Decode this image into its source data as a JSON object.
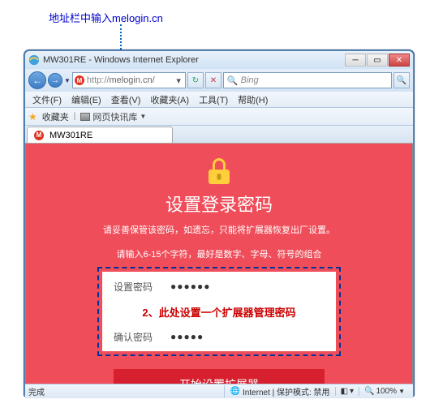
{
  "annotation": "地址栏中输入melogin.cn",
  "window": {
    "title": "MW301RE - Windows Internet Explorer",
    "url_prefix": "http://",
    "url_host": "melogin.cn/",
    "search_placeholder": "Bing"
  },
  "menu": {
    "file": "文件(F)",
    "edit": "编辑(E)",
    "view": "查看(V)",
    "favorites": "收藏夹(A)",
    "tools": "工具(T)",
    "help": "帮助(H)"
  },
  "favbar": {
    "label": "收藏夹",
    "item1": "网页快讯库"
  },
  "tab": {
    "label": "MW301RE"
  },
  "page": {
    "title": "设置登录密码",
    "subtitle": "请妥善保管该密码，如遗忘，只能将扩展器恢复出厂设置。",
    "hint": "请输入6-15个字符，最好是数字、字母、符号的组合",
    "pwd_label": "设置密码",
    "pwd_value": "●●●●●●",
    "confirm_label": "确认密码",
    "confirm_value": "●●●●●",
    "callout": "2、此处设置一个扩展器管理密码",
    "submit": "开始设置扩展器"
  },
  "status": {
    "done": "完成",
    "zone": "Internet | 保护模式: 禁用",
    "zoom": "100%"
  }
}
